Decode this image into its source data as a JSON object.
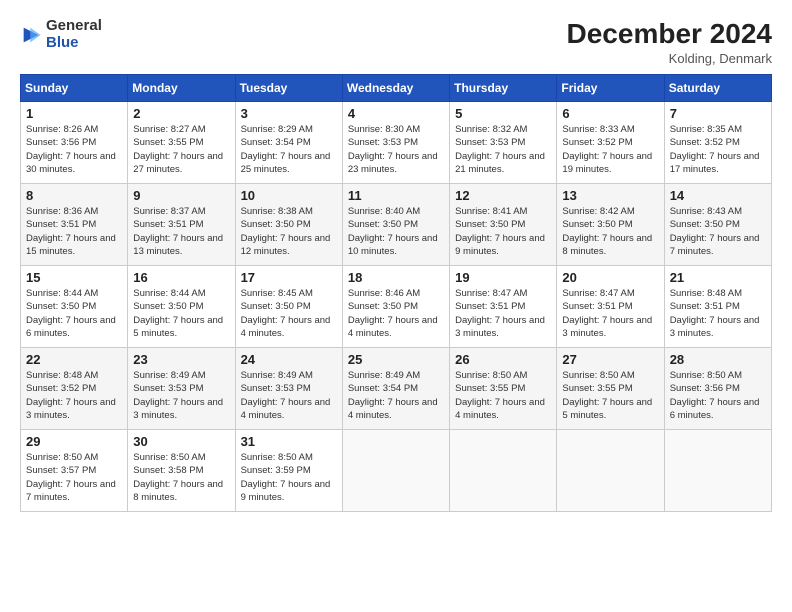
{
  "logo": {
    "line1": "General",
    "line2": "Blue"
  },
  "header": {
    "month": "December 2024",
    "location": "Kolding, Denmark"
  },
  "weekdays": [
    "Sunday",
    "Monday",
    "Tuesday",
    "Wednesday",
    "Thursday",
    "Friday",
    "Saturday"
  ],
  "weeks": [
    [
      {
        "day": "1",
        "rise": "Sunrise: 8:26 AM",
        "set": "Sunset: 3:56 PM",
        "daylight": "Daylight: 7 hours and 30 minutes."
      },
      {
        "day": "2",
        "rise": "Sunrise: 8:27 AM",
        "set": "Sunset: 3:55 PM",
        "daylight": "Daylight: 7 hours and 27 minutes."
      },
      {
        "day": "3",
        "rise": "Sunrise: 8:29 AM",
        "set": "Sunset: 3:54 PM",
        "daylight": "Daylight: 7 hours and 25 minutes."
      },
      {
        "day": "4",
        "rise": "Sunrise: 8:30 AM",
        "set": "Sunset: 3:53 PM",
        "daylight": "Daylight: 7 hours and 23 minutes."
      },
      {
        "day": "5",
        "rise": "Sunrise: 8:32 AM",
        "set": "Sunset: 3:53 PM",
        "daylight": "Daylight: 7 hours and 21 minutes."
      },
      {
        "day": "6",
        "rise": "Sunrise: 8:33 AM",
        "set": "Sunset: 3:52 PM",
        "daylight": "Daylight: 7 hours and 19 minutes."
      },
      {
        "day": "7",
        "rise": "Sunrise: 8:35 AM",
        "set": "Sunset: 3:52 PM",
        "daylight": "Daylight: 7 hours and 17 minutes."
      }
    ],
    [
      {
        "day": "8",
        "rise": "Sunrise: 8:36 AM",
        "set": "Sunset: 3:51 PM",
        "daylight": "Daylight: 7 hours and 15 minutes."
      },
      {
        "day": "9",
        "rise": "Sunrise: 8:37 AM",
        "set": "Sunset: 3:51 PM",
        "daylight": "Daylight: 7 hours and 13 minutes."
      },
      {
        "day": "10",
        "rise": "Sunrise: 8:38 AM",
        "set": "Sunset: 3:50 PM",
        "daylight": "Daylight: 7 hours and 12 minutes."
      },
      {
        "day": "11",
        "rise": "Sunrise: 8:40 AM",
        "set": "Sunset: 3:50 PM",
        "daylight": "Daylight: 7 hours and 10 minutes."
      },
      {
        "day": "12",
        "rise": "Sunrise: 8:41 AM",
        "set": "Sunset: 3:50 PM",
        "daylight": "Daylight: 7 hours and 9 minutes."
      },
      {
        "day": "13",
        "rise": "Sunrise: 8:42 AM",
        "set": "Sunset: 3:50 PM",
        "daylight": "Daylight: 7 hours and 8 minutes."
      },
      {
        "day": "14",
        "rise": "Sunrise: 8:43 AM",
        "set": "Sunset: 3:50 PM",
        "daylight": "Daylight: 7 hours and 7 minutes."
      }
    ],
    [
      {
        "day": "15",
        "rise": "Sunrise: 8:44 AM",
        "set": "Sunset: 3:50 PM",
        "daylight": "Daylight: 7 hours and 6 minutes."
      },
      {
        "day": "16",
        "rise": "Sunrise: 8:44 AM",
        "set": "Sunset: 3:50 PM",
        "daylight": "Daylight: 7 hours and 5 minutes."
      },
      {
        "day": "17",
        "rise": "Sunrise: 8:45 AM",
        "set": "Sunset: 3:50 PM",
        "daylight": "Daylight: 7 hours and 4 minutes."
      },
      {
        "day": "18",
        "rise": "Sunrise: 8:46 AM",
        "set": "Sunset: 3:50 PM",
        "daylight": "Daylight: 7 hours and 4 minutes."
      },
      {
        "day": "19",
        "rise": "Sunrise: 8:47 AM",
        "set": "Sunset: 3:51 PM",
        "daylight": "Daylight: 7 hours and 3 minutes."
      },
      {
        "day": "20",
        "rise": "Sunrise: 8:47 AM",
        "set": "Sunset: 3:51 PM",
        "daylight": "Daylight: 7 hours and 3 minutes."
      },
      {
        "day": "21",
        "rise": "Sunrise: 8:48 AM",
        "set": "Sunset: 3:51 PM",
        "daylight": "Daylight: 7 hours and 3 minutes."
      }
    ],
    [
      {
        "day": "22",
        "rise": "Sunrise: 8:48 AM",
        "set": "Sunset: 3:52 PM",
        "daylight": "Daylight: 7 hours and 3 minutes."
      },
      {
        "day": "23",
        "rise": "Sunrise: 8:49 AM",
        "set": "Sunset: 3:53 PM",
        "daylight": "Daylight: 7 hours and 3 minutes."
      },
      {
        "day": "24",
        "rise": "Sunrise: 8:49 AM",
        "set": "Sunset: 3:53 PM",
        "daylight": "Daylight: 7 hours and 4 minutes."
      },
      {
        "day": "25",
        "rise": "Sunrise: 8:49 AM",
        "set": "Sunset: 3:54 PM",
        "daylight": "Daylight: 7 hours and 4 minutes."
      },
      {
        "day": "26",
        "rise": "Sunrise: 8:50 AM",
        "set": "Sunset: 3:55 PM",
        "daylight": "Daylight: 7 hours and 4 minutes."
      },
      {
        "day": "27",
        "rise": "Sunrise: 8:50 AM",
        "set": "Sunset: 3:55 PM",
        "daylight": "Daylight: 7 hours and 5 minutes."
      },
      {
        "day": "28",
        "rise": "Sunrise: 8:50 AM",
        "set": "Sunset: 3:56 PM",
        "daylight": "Daylight: 7 hours and 6 minutes."
      }
    ],
    [
      {
        "day": "29",
        "rise": "Sunrise: 8:50 AM",
        "set": "Sunset: 3:57 PM",
        "daylight": "Daylight: 7 hours and 7 minutes."
      },
      {
        "day": "30",
        "rise": "Sunrise: 8:50 AM",
        "set": "Sunset: 3:58 PM",
        "daylight": "Daylight: 7 hours and 8 minutes."
      },
      {
        "day": "31",
        "rise": "Sunrise: 8:50 AM",
        "set": "Sunset: 3:59 PM",
        "daylight": "Daylight: 7 hours and 9 minutes."
      },
      null,
      null,
      null,
      null
    ]
  ]
}
